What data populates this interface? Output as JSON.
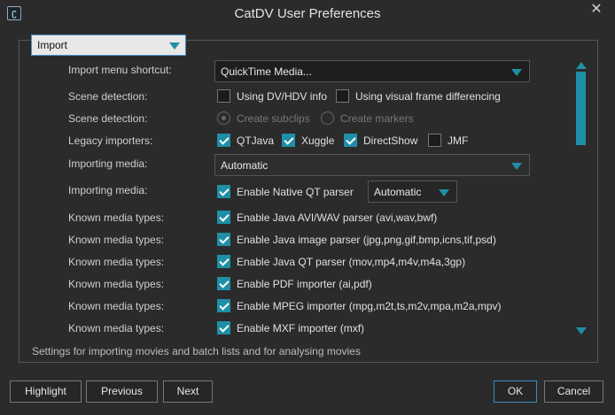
{
  "window": {
    "title": "CatDV User Preferences",
    "close_glyph": "✕",
    "app_icon_glyph": "ʗ"
  },
  "section": {
    "selected": "Import"
  },
  "rows": [
    {
      "label": "Import menu shortcut:",
      "combo_value": "QuickTime Media..."
    },
    {
      "label": "Scene detection:",
      "options": [
        "Using DV/HDV info",
        "Using visual frame differencing"
      ]
    },
    {
      "label": "Scene detection:",
      "options": [
        "Create subclips",
        "Create markers"
      ]
    },
    {
      "label": "Legacy importers:",
      "options": [
        "QTJava",
        "Xuggle",
        "DirectShow",
        "JMF"
      ]
    },
    {
      "label": "Importing media:",
      "combo_value": "Automatic"
    },
    {
      "label": "Importing media:",
      "option": "Enable Native QT parser",
      "combo_value": "Automatic"
    },
    {
      "label": "Known media types:",
      "option": "Enable Java AVI/WAV parser (avi,wav,bwf)"
    },
    {
      "label": "Known media types:",
      "option": "Enable Java image parser (jpg,png,gif,bmp,icns,tif,psd)"
    },
    {
      "label": "Known media types:",
      "option": "Enable Java QT parser (mov,mp4,m4v,m4a,3gp)"
    },
    {
      "label": "Known media types:",
      "option": "Enable PDF importer (ai,pdf)"
    },
    {
      "label": "Known media types:",
      "option": "Enable MPEG importer (mpg,m2t,ts,m2v,mpa,m2a,mpv)"
    },
    {
      "label": "Known media types:",
      "option": "Enable MXF importer (mxf)"
    }
  ],
  "help_text": "Settings for importing movies and batch lists and for analysing movies",
  "buttons": {
    "highlight": "Highlight",
    "previous": "Previous",
    "next": "Next",
    "ok": "OK",
    "cancel": "Cancel"
  },
  "colors": {
    "accent": "#1f8fa6",
    "background": "#2b2b2b"
  }
}
